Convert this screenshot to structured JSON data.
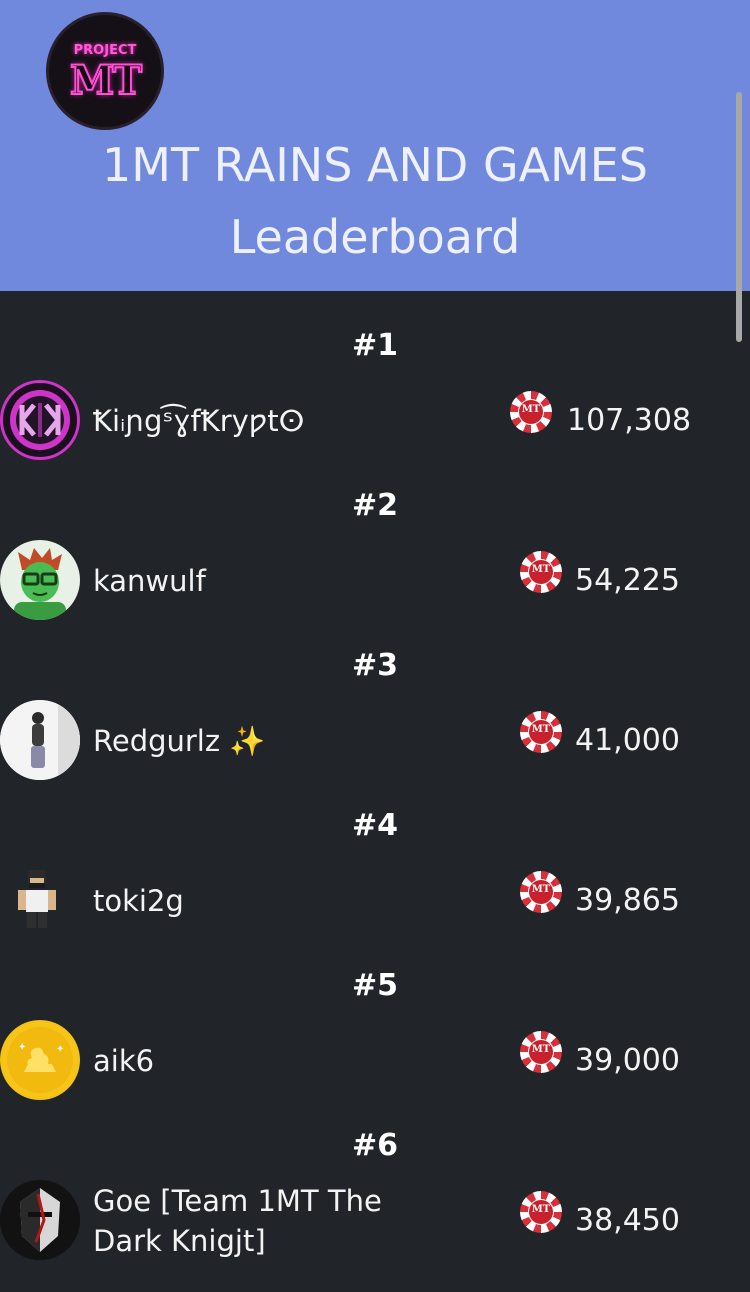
{
  "header": {
    "logo_top_text": "PROJECT",
    "logo_mark_text": "MT",
    "title": "1MT RAINS AND GAMES",
    "subtitle": "Leaderboard",
    "background_color": "#7089dc"
  },
  "currency": {
    "icon": "poker-chip-icon",
    "chip_text": "MT",
    "color": "#d82f3a"
  },
  "leaderboard": [
    {
      "rank": "#1",
      "name": "Ꝁiᵢɲgˢ͡ɣfꝀryƿtⵙ",
      "score": "107,308",
      "avatar": "kk-logo-avatar"
    },
    {
      "rank": "#2",
      "name": "kanwulf",
      "score": "54,225",
      "avatar": "green-character-avatar"
    },
    {
      "rank": "#3",
      "name": "Redgurlz ✨",
      "score": "41,000",
      "avatar": "person-photo-avatar"
    },
    {
      "rank": "#4",
      "name": "toki2g",
      "score": "39,865",
      "avatar": "roblox-character-avatar"
    },
    {
      "rank": "#5",
      "name": "aik6",
      "score": "39,000",
      "avatar": "gold-coin-avatar"
    },
    {
      "rank": "#6",
      "name": "Goe [Team 1MT The Dark Knigjt]",
      "score": "38,450",
      "avatar": "dark-knight-avatar"
    }
  ]
}
